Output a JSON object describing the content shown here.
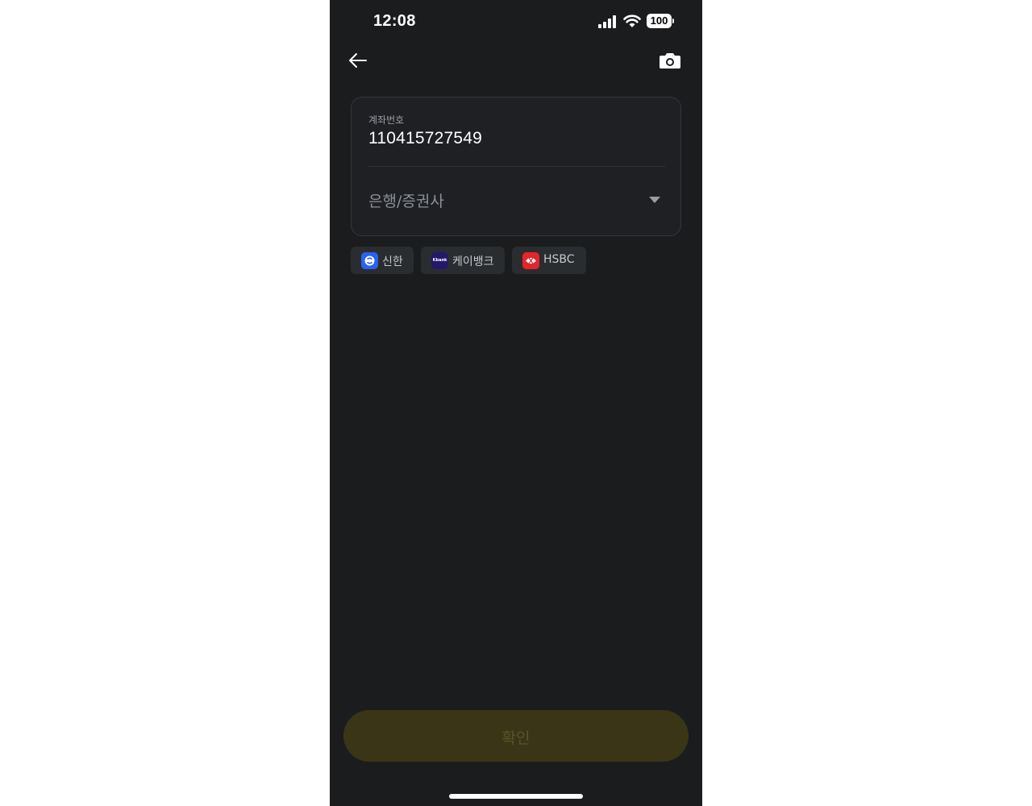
{
  "status_bar": {
    "time": "12:08",
    "battery": "100",
    "icons": [
      "signal-icon",
      "wifi-icon",
      "battery-icon"
    ]
  },
  "nav": {
    "back_icon": "arrow-left-icon",
    "camera_icon": "camera-icon"
  },
  "form": {
    "account_label": "계좌번호",
    "account_value": "110415727549",
    "bank_placeholder": "은행/증권사"
  },
  "quick_banks": [
    {
      "label": "신한",
      "logo": "shinhan-logo",
      "color": "#2a62f0"
    },
    {
      "label": "케이뱅크",
      "logo": "kbank-logo",
      "logo_text": "Kbank",
      "color": "#23186a"
    },
    {
      "label": "HSBC",
      "logo": "hsbc-logo",
      "color": "#e3262b"
    }
  ],
  "confirm": {
    "label": "확인",
    "state": "disabled"
  },
  "colors": {
    "background": "#1a1c1e",
    "button_disabled": "#3a3517"
  }
}
